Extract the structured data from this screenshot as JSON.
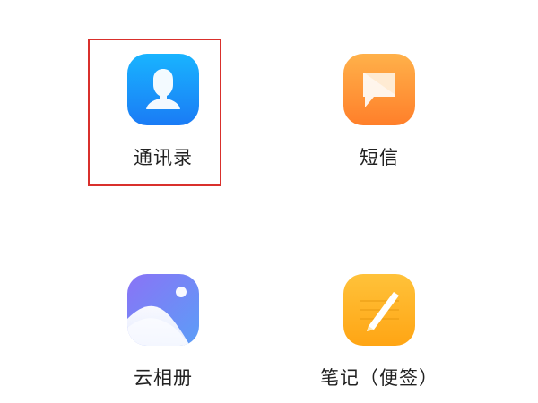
{
  "apps": [
    {
      "id": "contacts",
      "label": "通讯录",
      "icon": "contacts-icon",
      "color": "#1E90FF",
      "selected": true
    },
    {
      "id": "sms",
      "label": "短信",
      "icon": "message-icon",
      "color": "#FF9A2E",
      "selected": false
    },
    {
      "id": "gallery",
      "label": "云相册",
      "icon": "gallery-icon",
      "color": "#7B82F0",
      "selected": false
    },
    {
      "id": "notes",
      "label": "笔记（便签）",
      "icon": "notes-icon",
      "color": "#FFB31A",
      "selected": false
    }
  ],
  "highlight": {
    "color": "#D9302C",
    "target": "contacts"
  }
}
